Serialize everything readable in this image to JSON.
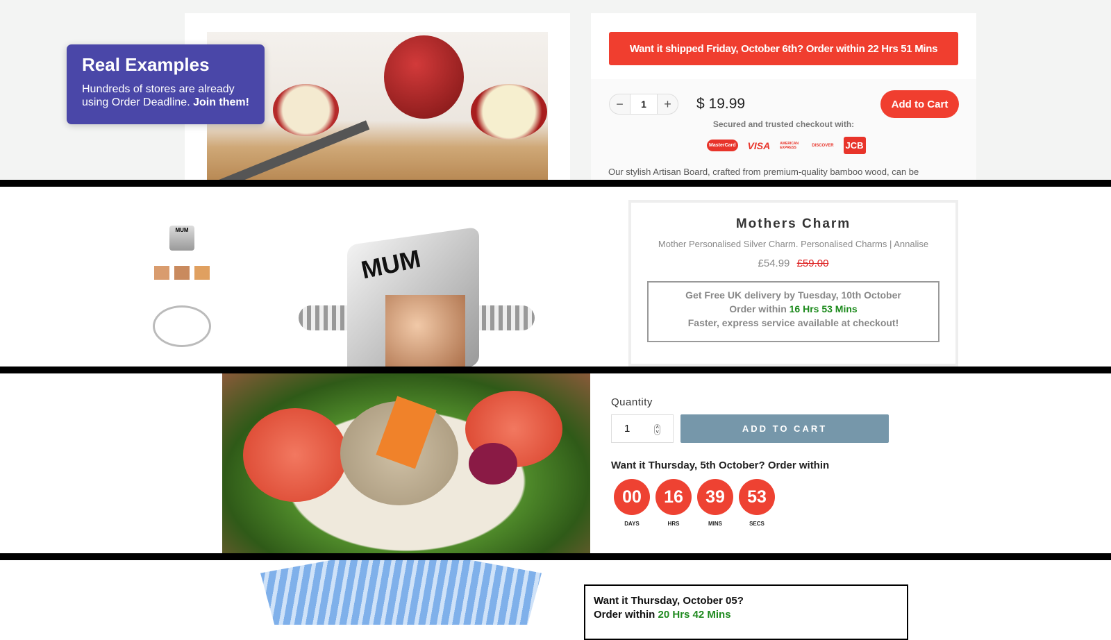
{
  "promo": {
    "title": "Real Examples",
    "text": "Hundreds of stores are already using Order Deadline.",
    "cta": "Join them!"
  },
  "example1": {
    "banner": "Want it shipped Friday, October 6th?  Order within 22 Hrs 51 Mins",
    "quantity": "1",
    "minus": "−",
    "plus": "+",
    "price": "$ 19.99",
    "add_to_cart": "Add to Cart",
    "secure_text": "Secured and trusted checkout with:",
    "payment_icons": [
      "MasterCard",
      "VISA",
      "AMERICAN EXPRESS",
      "DISCOVER",
      "JCB"
    ],
    "description": "Our stylish Artisan Board, crafted from premium-quality bamboo wood,  can be",
    "accent": "#f03e2f"
  },
  "example2": {
    "title": "Mothers Charm",
    "subtitle": "Mother Personalised Silver Charm. Personalised Charms | Annalise",
    "price": "£54.99",
    "old_price": "£59.00",
    "delivery_line": "Get Free UK delivery by Tuesday, 10th October",
    "order_prefix": "Order within",
    "order_time": "16 Hrs 53 Mins",
    "express_line": "Faster, express service available at checkout!",
    "thumb_label": "MUM",
    "image_label": "MUM"
  },
  "example3": {
    "quantity_label": "Quantity",
    "quantity": "1",
    "add_to_cart": "ADD TO CART",
    "heading": "Want it Thursday, 5th October? Order within",
    "countdown": [
      {
        "value": "00",
        "label": "DAYS"
      },
      {
        "value": "16",
        "label": "HRS"
      },
      {
        "value": "39",
        "label": "MINS"
      },
      {
        "value": "53",
        "label": "SECS"
      }
    ],
    "accent": "#ee4232",
    "button_color": "#7697aa"
  },
  "example4": {
    "line1": "Want it Thursday, October 05?",
    "order_prefix": "Order within",
    "order_time": "20 Hrs 42 Mins"
  }
}
